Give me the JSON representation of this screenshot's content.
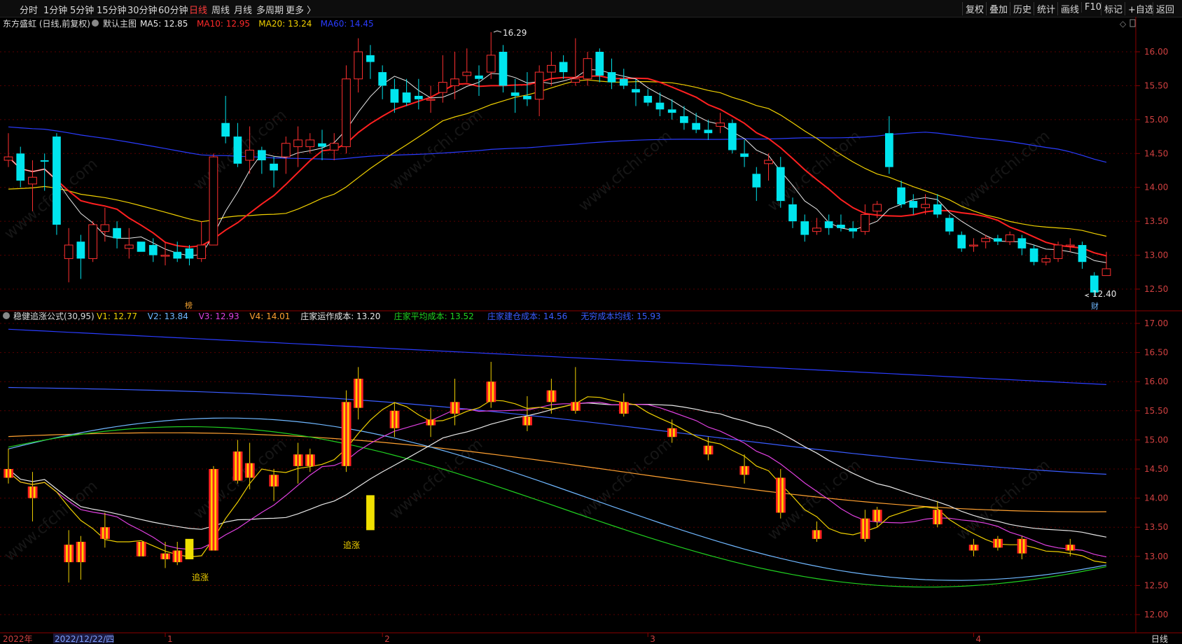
{
  "toolbar": {
    "periods": [
      {
        "label": "分时",
        "active": false
      },
      {
        "label": "1分钟",
        "active": false
      },
      {
        "label": "5分钟",
        "active": false
      },
      {
        "label": "15分钟",
        "active": false
      },
      {
        "label": "30分钟",
        "active": false
      },
      {
        "label": "60分钟",
        "active": false
      },
      {
        "label": "日线",
        "active": true
      },
      {
        "label": "周线",
        "active": false
      },
      {
        "label": "月线",
        "active": false
      },
      {
        "label": "多周期",
        "active": false
      },
      {
        "label": "更多 〉",
        "active": false
      }
    ],
    "right_buttons": [
      "复权",
      "叠加",
      "历史",
      "统计",
      "画线",
      "F10",
      "标记",
      "+自选",
      "返回"
    ]
  },
  "main_panel": {
    "stock_title": "东方盛虹 (日线,前复权)",
    "template_label": "默认主图",
    "indicators": [
      {
        "text": "MA5: 12.85",
        "color": "#e8e8e8"
      },
      {
        "text": "MA10: 12.95",
        "color": "#ff2a2a"
      },
      {
        "text": "MA20: 13.24",
        "color": "#f0d000"
      },
      {
        "text": "MA60: 14.45",
        "color": "#2a3cff"
      }
    ],
    "price_axis": [
      "16.00",
      "15.50",
      "15.00",
      "14.50",
      "14.00",
      "13.50",
      "13.00",
      "12.50"
    ],
    "high_marker": "16.29",
    "low_marker": "12.40",
    "badge_left": "榜",
    "badge_right": "财"
  },
  "sub_panel": {
    "formula_title": "稳健追涨公式(30,95)",
    "values": [
      {
        "text": "V1: 12.77",
        "color": "#f0d000"
      },
      {
        "text": "V2: 13.84",
        "color": "#6fb7ff"
      },
      {
        "text": "V3: 12.93",
        "color": "#e040e0"
      },
      {
        "text": "V4: 14.01",
        "color": "#ffa030"
      },
      {
        "text": "庄家运作成本: 13.20",
        "color": "#e8e8e8"
      },
      {
        "text": "庄家平均成本: 13.52",
        "color": "#20d020"
      },
      {
        "text": "庄家建仓成本: 14.56",
        "color": "#3a5cff"
      },
      {
        "text": "无穷成本均线: 15.93",
        "color": "#3a5cff"
      }
    ],
    "price_axis": [
      "17.00",
      "16.50",
      "16.00",
      "15.50",
      "15.00",
      "14.50",
      "14.00",
      "13.50",
      "13.00",
      "12.50",
      "12.00"
    ],
    "signal_label": "追涨"
  },
  "date_axis": {
    "year_label": "2022年",
    "cursor_date": "2022/12/22/四",
    "month_ticks": [
      "1",
      "2",
      "3",
      "4"
    ]
  },
  "period_footer": "日线",
  "watermark": "www.cfchi.com",
  "colors": {
    "up": "#ff3030",
    "down": "#00e5ee",
    "ma5": "#e8e8e8",
    "ma10": "#ff2020",
    "ma20": "#f0d000",
    "ma60": "#2a3cff",
    "bg": "#000000"
  },
  "chart_data": {
    "type": "candlestick",
    "candles": [
      [
        14.4,
        14.45,
        14.8,
        14.3
      ],
      [
        14.5,
        14.1,
        14.6,
        14.0
      ],
      [
        14.05,
        14.15,
        14.4,
        13.65
      ],
      [
        14.4,
        14.38,
        14.5,
        13.95
      ],
      [
        14.75,
        13.45,
        14.8,
        13.3
      ],
      [
        12.95,
        13.15,
        13.4,
        12.6
      ],
      [
        13.2,
        12.95,
        13.3,
        12.65
      ],
      [
        12.95,
        13.45,
        13.5,
        12.9
      ],
      [
        13.35,
        13.45,
        13.7,
        13.2
      ],
      [
        13.4,
        13.25,
        13.5,
        13.1
      ],
      [
        13.1,
        13.15,
        13.4,
        12.95
      ],
      [
        13.2,
        13.05,
        13.2,
        13.05
      ],
      [
        13.15,
        13.0,
        13.25,
        12.9
      ],
      [
        13.0,
        13.0,
        13.2,
        12.85
      ],
      [
        13.05,
        12.95,
        13.2,
        12.9
      ],
      [
        13.1,
        12.95,
        13.15,
        12.85
      ],
      [
        12.95,
        13.15,
        13.5,
        12.9
      ],
      [
        13.15,
        14.45,
        14.5,
        13.15
      ],
      [
        14.95,
        14.75,
        15.35,
        14.65
      ],
      [
        14.75,
        14.35,
        14.95,
        14.3
      ],
      [
        14.4,
        14.55,
        14.9,
        14.2
      ],
      [
        14.55,
        14.4,
        14.6,
        14.2
      ],
      [
        14.35,
        14.25,
        14.45,
        14.0
      ],
      [
        14.45,
        14.65,
        14.75,
        14.2
      ],
      [
        14.6,
        14.7,
        14.9,
        14.3
      ],
      [
        14.6,
        14.7,
        14.8,
        14.5
      ],
      [
        14.65,
        14.6,
        14.85,
        14.4
      ],
      [
        14.55,
        14.65,
        14.8,
        14.4
      ],
      [
        14.6,
        15.6,
        15.8,
        14.5
      ],
      [
        15.6,
        16.0,
        16.2,
        15.4
      ],
      [
        15.95,
        15.85,
        16.1,
        15.6
      ],
      [
        15.7,
        15.5,
        15.8,
        15.3
      ],
      [
        15.45,
        15.25,
        15.6,
        15.1
      ],
      [
        15.4,
        15.25,
        15.6,
        15.2
      ],
      [
        15.35,
        15.3,
        15.6,
        15.15
      ],
      [
        15.3,
        15.3,
        15.5,
        15.1
      ],
      [
        15.4,
        15.55,
        15.95,
        15.25
      ],
      [
        15.5,
        15.6,
        16.0,
        15.3
      ],
      [
        15.65,
        15.7,
        16.05,
        15.55
      ],
      [
        15.65,
        15.6,
        15.8,
        15.35
      ],
      [
        15.7,
        15.95,
        16.29,
        15.6
      ],
      [
        16.0,
        15.5,
        16.1,
        15.4
      ],
      [
        15.4,
        15.35,
        15.6,
        15.1
      ],
      [
        15.35,
        15.3,
        15.7,
        15.2
      ],
      [
        15.3,
        15.7,
        15.8,
        15.05
      ],
      [
        15.7,
        15.8,
        16.0,
        15.5
      ],
      [
        15.85,
        15.7,
        15.95,
        15.6
      ],
      [
        15.55,
        15.6,
        16.2,
        15.5
      ],
      [
        15.6,
        15.9,
        16.0,
        15.5
      ],
      [
        16.0,
        15.65,
        16.05,
        15.55
      ],
      [
        15.7,
        15.55,
        15.9,
        15.45
      ],
      [
        15.6,
        15.5,
        15.75,
        15.45
      ],
      [
        15.45,
        15.4,
        15.6,
        15.2
      ],
      [
        15.35,
        15.25,
        15.45,
        15.2
      ],
      [
        15.25,
        15.15,
        15.4,
        15.05
      ],
      [
        15.15,
        15.1,
        15.3,
        15.0
      ],
      [
        15.05,
        14.95,
        15.2,
        14.85
      ],
      [
        14.95,
        14.85,
        15.1,
        14.8
      ],
      [
        14.85,
        14.8,
        15.0,
        14.7
      ],
      [
        14.9,
        14.95,
        15.1,
        14.8
      ],
      [
        14.95,
        14.55,
        15.0,
        14.5
      ],
      [
        14.5,
        14.45,
        14.7,
        14.3
      ],
      [
        14.2,
        14.0,
        14.3,
        13.8
      ],
      [
        14.35,
        14.4,
        14.5,
        14.1
      ],
      [
        14.3,
        13.8,
        14.45,
        13.7
      ],
      [
        13.75,
        13.5,
        13.85,
        13.4
      ],
      [
        13.5,
        13.3,
        13.6,
        13.2
      ],
      [
        13.35,
        13.4,
        13.55,
        13.3
      ],
      [
        13.5,
        13.4,
        13.6,
        13.3
      ],
      [
        13.45,
        13.4,
        13.6,
        13.35
      ],
      [
        13.4,
        13.35,
        13.5,
        13.25
      ],
      [
        13.35,
        13.6,
        13.75,
        13.3
      ],
      [
        13.65,
        13.75,
        13.8,
        13.55
      ],
      [
        14.8,
        14.3,
        15.05,
        14.2
      ],
      [
        14.0,
        13.75,
        14.1,
        13.7
      ],
      [
        13.8,
        13.7,
        13.9,
        13.6
      ],
      [
        13.7,
        13.75,
        13.9,
        13.6
      ],
      [
        13.75,
        13.6,
        13.9,
        13.55
      ],
      [
        13.55,
        13.35,
        13.6,
        13.3
      ],
      [
        13.3,
        13.1,
        13.35,
        13.05
      ],
      [
        13.15,
        13.15,
        13.25,
        13.05
      ],
      [
        13.2,
        13.25,
        13.3,
        13.1
      ],
      [
        13.25,
        13.2,
        13.3,
        13.15
      ],
      [
        13.2,
        13.3,
        13.35,
        13.15
      ],
      [
        13.25,
        13.1,
        13.3,
        13.0
      ],
      [
        13.1,
        12.9,
        13.15,
        12.85
      ],
      [
        12.9,
        12.95,
        13.0,
        12.85
      ],
      [
        12.95,
        13.15,
        13.2,
        12.9
      ],
      [
        13.15,
        13.15,
        13.25,
        13.05
      ],
      [
        13.15,
        12.9,
        13.2,
        12.8
      ],
      [
        12.7,
        12.45,
        12.75,
        12.4
      ],
      [
        12.7,
        12.8,
        13.05,
        12.7
      ]
    ]
  }
}
